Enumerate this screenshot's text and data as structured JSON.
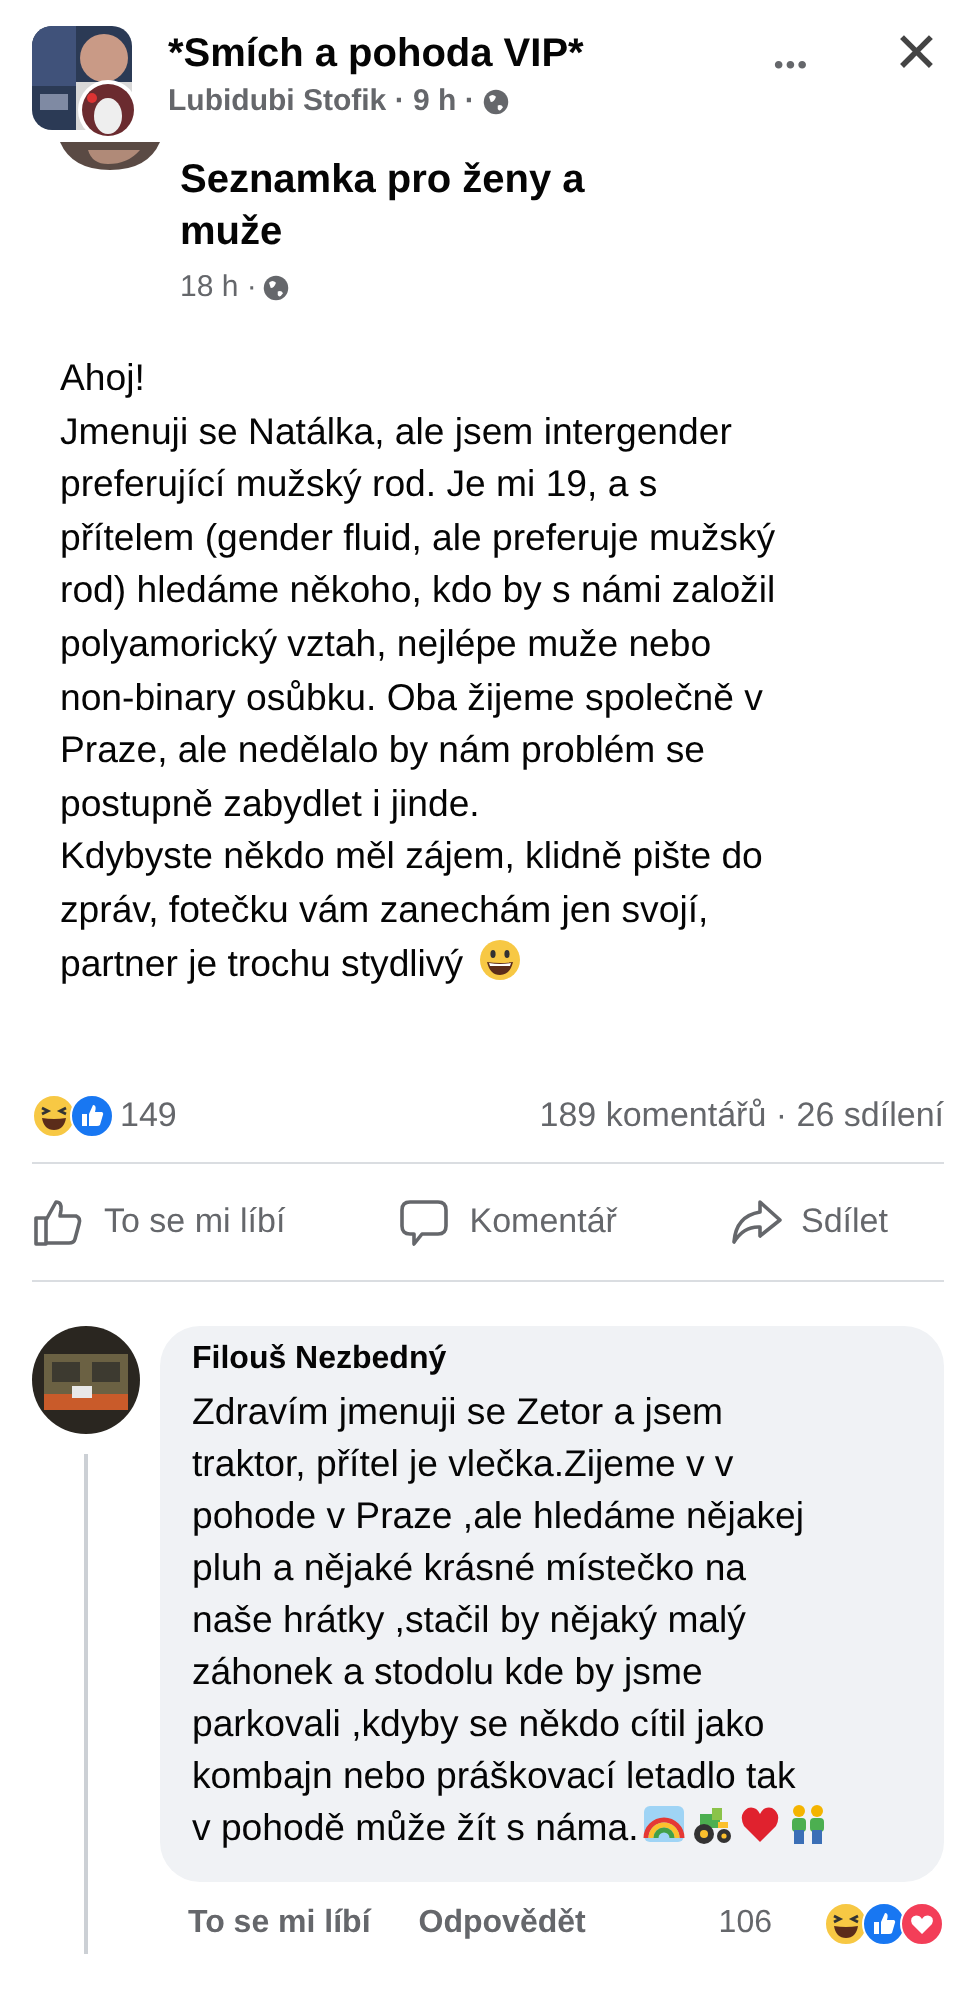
{
  "header": {
    "group_name": "*Smích a pohoda VIP*",
    "meta": "Lubidubi Stofik · 9 h ·",
    "more": "•••",
    "close": "✕"
  },
  "shared_post": {
    "title": "Seznamka pro ženy a\nmuže",
    "meta": "18 h ·",
    "body": "Ahoj!\nJmenuji se Natálka, ale jsem intergender\npreferující mužský rod. Je mi 19, a s\npřítelem (gender fluid, ale preferuje mužský\nrod) hledáme někoho, kdo by s námi založil\npolyamorický vztah, nejlépe muže nebo\nnon-binary osůbku. Oba žijeme společně v\nPraze, ale nedělalo by nám problém se\npostupně zabydlet i jinde.\nKdybyste někdo měl zájem, klidně pište do\nzpráv, fotečku vám zanechám jen svojí,\npartner je trochu stydlivý",
    "body_emojis": [
      {
        "kind": "grin"
      }
    ]
  },
  "stats": {
    "reactions": [
      {
        "kind": "haha"
      },
      {
        "kind": "like"
      }
    ],
    "reaction_count": "149",
    "comments_shares": "189 komentářů · 26 sdílení"
  },
  "actions": [
    {
      "kind": "like",
      "label": "To se mi líbí"
    },
    {
      "kind": "comment",
      "label": "Komentář"
    },
    {
      "kind": "share",
      "label": "Sdílet"
    }
  ],
  "comment": {
    "author": "Filouš Nezbedný",
    "text": "Zdravím jmenuji se Zetor a jsem\ntraktor, přítel je vlečka.Zijeme v v\npohode v Praze ,ale hledáme nějakej\npluh a nějaké krásné místečko na\nnaše hrátky ,stačil by nějaký malý\nzáhonek a stodolu kde by jsme\nparkovali ,kdyby  se někdo cítil jako\nkombajn nebo práškovací letadlo tak\nv pohodě může žít s náma.",
    "emojis": [
      {
        "kind": "rainbow"
      },
      {
        "kind": "tractor"
      },
      {
        "kind": "heart"
      },
      {
        "kind": "two-men"
      }
    ],
    "like": "To se mi líbí",
    "reply": "Odpovědět",
    "reaction_count": "106",
    "reactions": [
      {
        "kind": "haha"
      },
      {
        "kind": "like"
      },
      {
        "kind": "love"
      }
    ]
  }
}
